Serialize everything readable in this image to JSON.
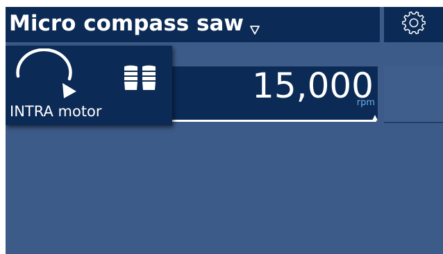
{
  "header": {
    "title": "Micro compass saw",
    "mode_dropdown_icon": "triangle-down-outline-icon",
    "settings_icon": "gear-icon"
  },
  "motor": {
    "label": "INTRA motor",
    "rotation_icon": "clockwise-rotation-icon",
    "control_icon": "foot-pedal-icon"
  },
  "speed": {
    "value": "15,000",
    "unit": "rpm",
    "level": 1.0
  },
  "colors": {
    "background": "#3d5b88",
    "panel": "#0b2a55",
    "text": "#ffffff",
    "unit_text": "#6fb0e8"
  }
}
